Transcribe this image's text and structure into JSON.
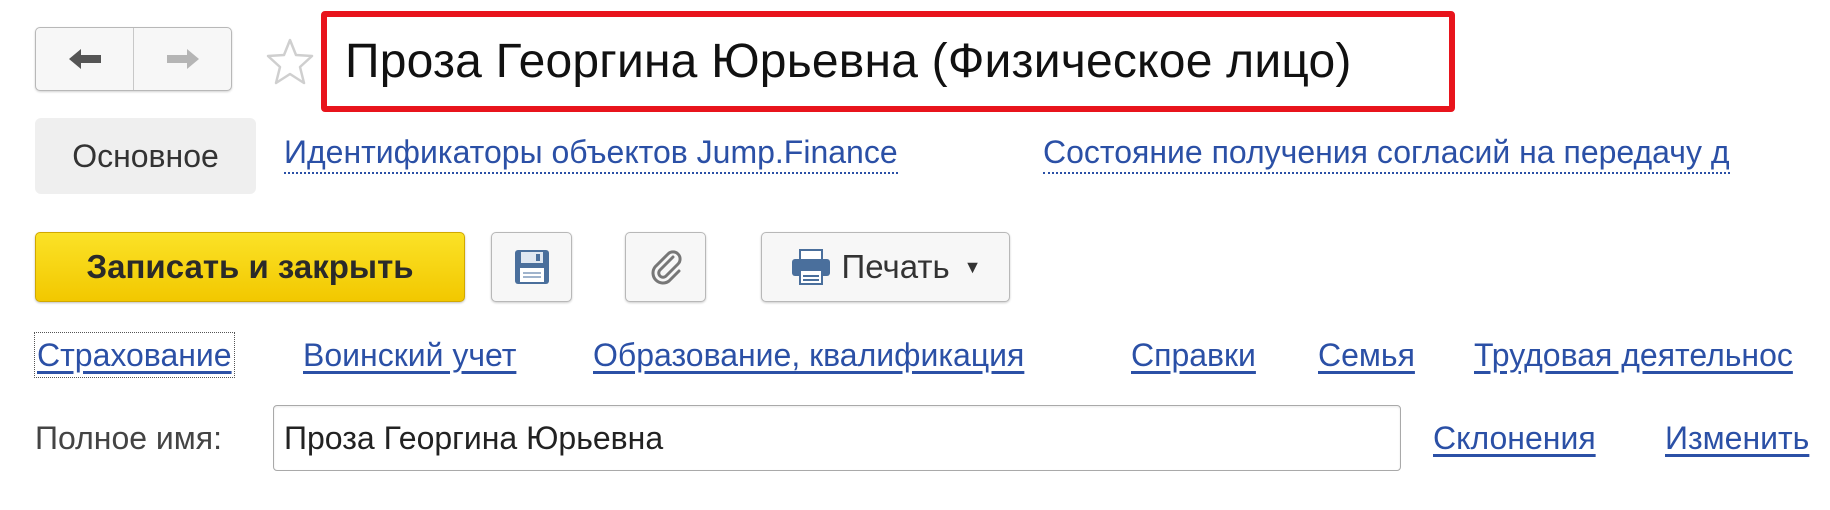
{
  "window": {
    "title": "Проза Георгина Юрьевна (Физическое лицо)"
  },
  "navigation": {
    "back_icon": "arrow-left-icon",
    "forward_icon": "arrow-right-icon",
    "favorite_icon": "star-outline-icon"
  },
  "tabs": [
    {
      "label": "Основное",
      "active": true
    },
    {
      "label": "Идентификаторы объектов Jump.Finance",
      "active": false
    },
    {
      "label": "Состояние получения согласий на передачу д",
      "active": false
    }
  ],
  "toolbar": {
    "save_close_label": "Записать и закрыть",
    "save_icon": "floppy-disk-icon",
    "attach_icon": "paperclip-icon",
    "print_label": "Печать",
    "print_icon": "printer-icon",
    "primary_color": "#f5d20f"
  },
  "sections": [
    {
      "label": "Страхование"
    },
    {
      "label": "Воинский учет"
    },
    {
      "label": "Образование, квалификация"
    },
    {
      "label": "Справки"
    },
    {
      "label": "Семья"
    },
    {
      "label": "Трудовая деятельнос"
    }
  ],
  "full_name": {
    "label": "Полное имя:",
    "value": "Проза Георгина Юрьевна",
    "declensions_link": "Склонения",
    "change_link": "Изменить"
  },
  "colors": {
    "highlight_border": "#e8141c",
    "link": "#2b50a6"
  }
}
